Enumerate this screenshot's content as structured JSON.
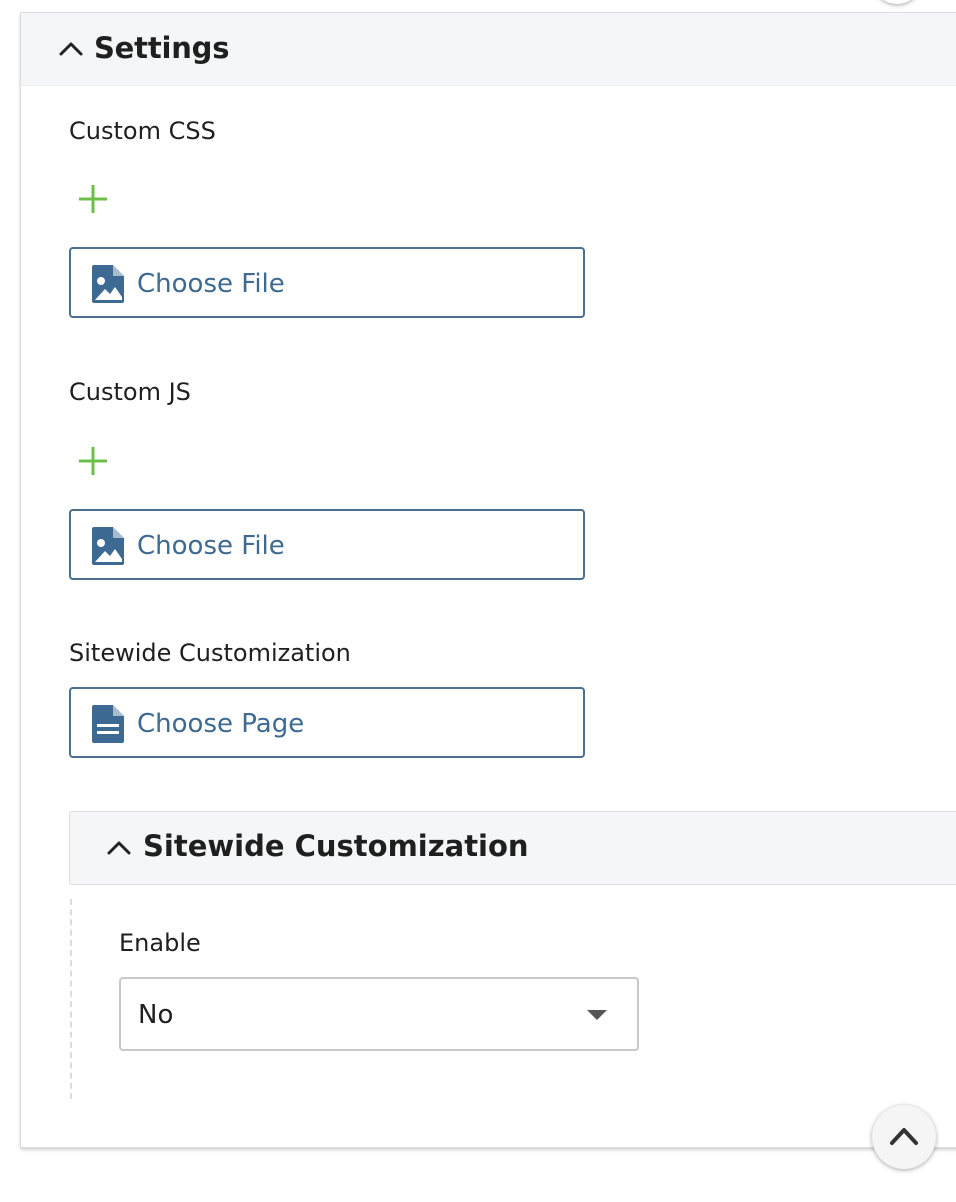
{
  "settings_panel": {
    "title": "Settings"
  },
  "custom_css": {
    "label": "Custom CSS",
    "button_label": "Choose File",
    "button_icon": "file-image-icon"
  },
  "custom_js": {
    "label": "Custom JS",
    "button_label": "Choose File",
    "button_icon": "file-image-icon"
  },
  "sitewide_customization_field": {
    "label": "Sitewide Customization",
    "button_label": "Choose Page",
    "button_icon": "file-text-icon"
  },
  "sitewide_customization_panel": {
    "title": "Sitewide Customization",
    "enable": {
      "label": "Enable",
      "selected_value": "No"
    }
  },
  "colors": {
    "accent_blue": "#3d6a92",
    "add_green": "#6cc04a",
    "header_bg": "#f5f6f7"
  }
}
